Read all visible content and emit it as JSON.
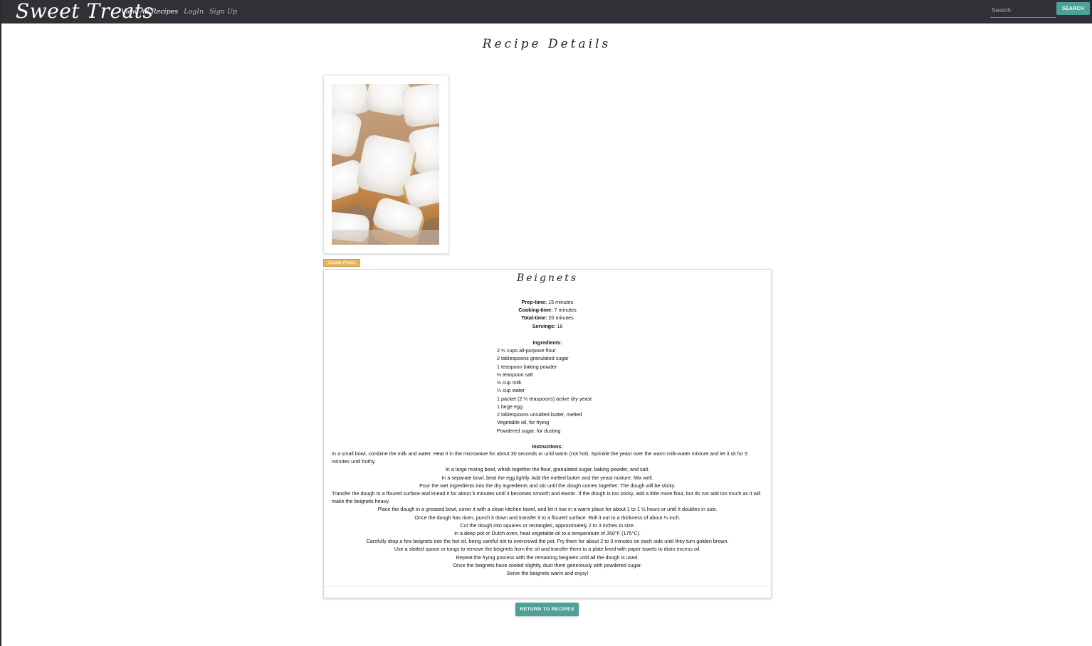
{
  "navbar": {
    "brand": "Sweet Treats",
    "links": [
      "View All Recipes",
      "LogIn",
      "Sign Up"
    ],
    "search_placeholder": "Search",
    "search_button": "SEARCH"
  },
  "page": {
    "title": "Recipe Details",
    "delete_photo_label": "Delete Photo",
    "return_label": "RETURN TO RECIPES"
  },
  "recipe": {
    "name": "Beignets",
    "prep_label": "Prep-time:",
    "prep_value": " 15 minutes",
    "cook_label": "Cooking-time:",
    "cook_value": " 7 minutes",
    "total_label": "Total-time:",
    "total_value": " 20 minutes",
    "servings_label": "Servings:",
    "servings_value": " 18",
    "ingredients_heading": "Ingredients:",
    "ingredients": [
      "2 ¼ cups all-purpose flour",
      "2 tablespoons granulated sugar",
      "1 teaspoon baking powder",
      "½ teaspoon salt",
      "½ cup milk",
      "¼ cup water",
      "1 packet (2 ¼ teaspoons) active dry yeast",
      "1 large egg",
      "2 tablespoons unsalted butter, melted",
      "Vegetable oil, for frying",
      "Powdered sugar, for dusting"
    ],
    "instructions_heading": "Instructions:",
    "instructions": [
      "In a small bowl, combine the milk and water. Heat it in the microwave for about 30 seconds or until warm (not hot). Sprinkle the yeast over the warm milk-water mixture and let it sit for 5 minutes until frothy.",
      "In a large mixing bowl, whisk together the flour, granulated sugar, baking powder, and salt.",
      "In a separate bowl, beat the egg lightly. Add the melted butter and the yeast mixture. Mix well.",
      "Pour the wet ingredients into the dry ingredients and stir until the dough comes together. The dough will be sticky.",
      "Transfer the dough to a floured surface and knead it for about 5 minutes until it becomes smooth and elastic. If the dough is too sticky, add a little more flour, but do not add too much as it will make the beignets heavy.",
      "Place the dough in a greased bowl, cover it with a clean kitchen towel, and let it rise in a warm place for about 1 to 1 ½ hours or until it doubles in size.",
      "Once the dough has risen, punch it down and transfer it to a floured surface. Roll it out to a thickness of about ¼ inch.",
      "Cut the dough into squares or rectangles, approximately 2 to 3 inches in size.",
      "In a deep pot or Dutch oven, heat vegetable oil to a temperature of 350°F (175°C).",
      "Carefully drop a few beignets into the hot oil, being careful not to overcrowd the pot. Fry them for about 2 to 3 minutes on each side until they turn golden brown.",
      "Use a slotted spoon or tongs to remove the beignets from the oil and transfer them to a plate lined with paper towels to drain excess oil.",
      "Repeat the frying process with the remaining beignets until all the dough is used.",
      "Once the beignets have cooled slightly, dust them generously with powdered sugar.",
      "Serve the beignets warm and enjoy!"
    ]
  }
}
